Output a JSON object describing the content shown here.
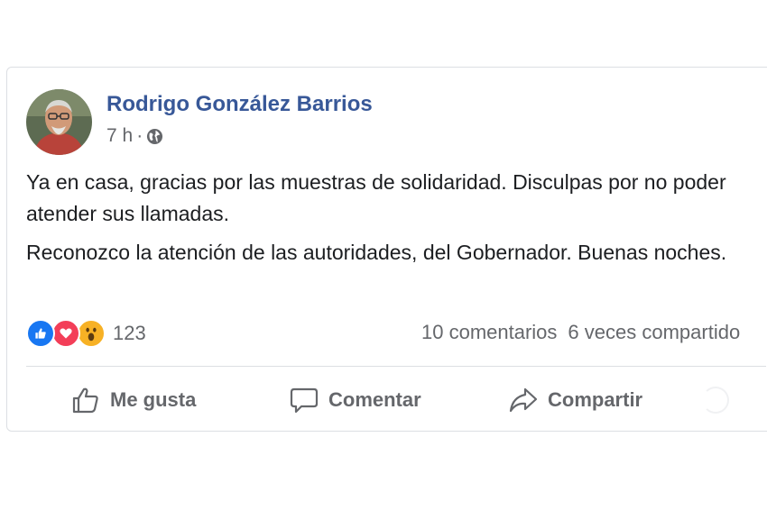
{
  "post": {
    "author": "Rodrigo González Barrios",
    "time": "7 h",
    "separator": "·",
    "visibility_icon": "globe-icon",
    "paragraphs": [
      "Ya en casa, gracias por las muestras de solidaridad. Disculpas por no poder atender sus llamadas.",
      "Reconozco la atención de las autoridades, del Gobernador. Buenas noches."
    ]
  },
  "engagement": {
    "reaction_icons": [
      "like-reaction-icon",
      "love-reaction-icon",
      "wow-reaction-icon"
    ],
    "reaction_count": "123",
    "comments": "10 comentarios",
    "shares": "6 veces compartido"
  },
  "actions": {
    "like_label": "Me gusta",
    "comment_label": "Comentar",
    "share_label": "Compartir"
  },
  "colors": {
    "author_link": "#385898",
    "like_blue": "#1877f2",
    "love_red": "#f33e58",
    "wow_yellow": "#f7b125",
    "secondary_text": "#65676b"
  }
}
